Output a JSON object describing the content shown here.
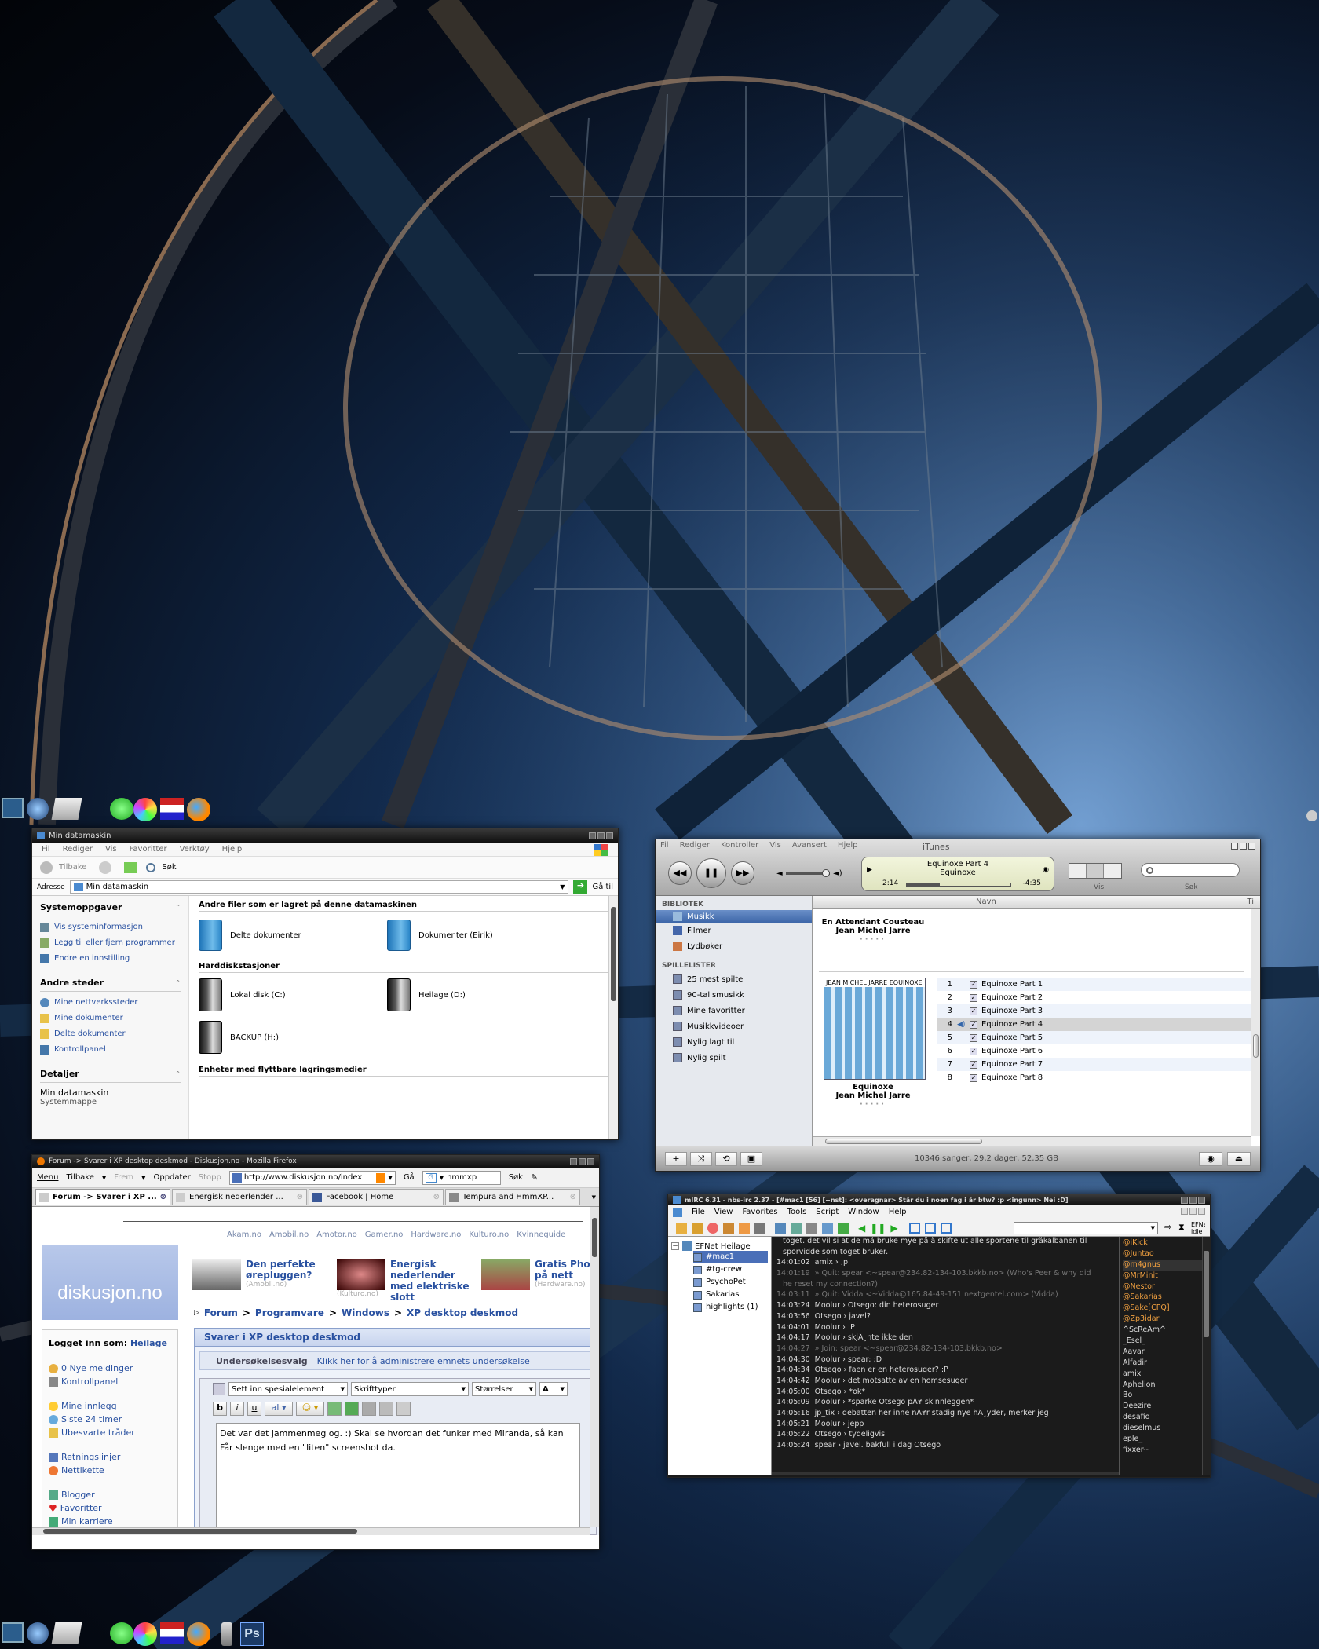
{
  "explorer": {
    "title": "Min datamaskin",
    "menu": [
      "Fil",
      "Rediger",
      "Vis",
      "Favoritter",
      "Verktøy",
      "Hjelp"
    ],
    "toolbar": {
      "back": "Tilbake",
      "search": "Søk"
    },
    "address": {
      "label": "Adresse",
      "value": "Min datamaskin",
      "go": "Gå til"
    },
    "tasks": {
      "title": "Systemoppgaver",
      "items": [
        "Vis systeminformasjon",
        "Legg til eller fjern programmer",
        "Endre en innstilling"
      ]
    },
    "places": {
      "title": "Andre steder",
      "items": [
        "Mine nettverkssteder",
        "Mine dokumenter",
        "Delte dokumenter",
        "Kontrollpanel"
      ]
    },
    "details": {
      "title": "Detaljer",
      "name": "Min datamaskin",
      "desc": "Systemmappe"
    },
    "groups": {
      "files": "Andre filer som er lagret på denne datamaskinen",
      "disks": "Harddiskstasjoner",
      "removable": "Enheter med flyttbare lagringsmedier"
    },
    "items": {
      "shared": "Delte dokumenter",
      "eirik": "Dokumenter (Eirik)",
      "c": "Lokal disk (C:)",
      "d": "Heilage (D:)",
      "h": "BACKUP (H:)"
    }
  },
  "itunes": {
    "title": "iTunes",
    "menu": [
      "Fil",
      "Rediger",
      "Kontroller",
      "Vis",
      "Avansert",
      "Hjelp"
    ],
    "now_playing": {
      "track": "Equinoxe Part 4",
      "album": "Equinoxe",
      "elapsed": "2:14",
      "remaining": "-4:35",
      "progress": 0.32
    },
    "view_label": "Vis",
    "search_label": "Søk",
    "library_header": "BIBLIOTEK",
    "library": [
      "Musikk",
      "Filmer",
      "Lydbøker"
    ],
    "playlists_header": "SPILLELISTER",
    "playlists": [
      "25 mest spilte",
      "90-tallsmusikk",
      "Mine favoritter",
      "Musikkvideoer",
      "Nylig lagt til",
      "Nylig spilt"
    ],
    "columns": {
      "name": "Navn",
      "time": "Ti"
    },
    "album1": {
      "title": "En Attendant Cousteau",
      "artist": "Jean Michel Jarre"
    },
    "album2": {
      "cover": "JEAN MICHEL JARRE  EQUINOXE",
      "title": "Equinoxe",
      "artist": "Jean Michel Jarre"
    },
    "tracks": [
      {
        "n": "1",
        "name": "Equinoxe Part 1"
      },
      {
        "n": "2",
        "name": "Equinoxe Part 2"
      },
      {
        "n": "3",
        "name": "Equinoxe Part 3"
      },
      {
        "n": "4",
        "name": "Equinoxe Part 4"
      },
      {
        "n": "5",
        "name": "Equinoxe Part 5"
      },
      {
        "n": "6",
        "name": "Equinoxe Part 6"
      },
      {
        "n": "7",
        "name": "Equinoxe Part 7"
      },
      {
        "n": "8",
        "name": "Equinoxe Part 8"
      }
    ],
    "status": "10346 sanger, 29,2 dager, 52,35 GB"
  },
  "firefox": {
    "title": "Forum -> Svarer i XP desktop deskmod - Diskusjon.no - Mozilla Firefox",
    "toolbar": {
      "menu": "Menu",
      "back": "Tilbake",
      "forward": "Frem",
      "reload": "Oppdater",
      "stop": "Stopp",
      "url": "http://www.diskusjon.no/index",
      "go": "Gå",
      "search_value": "hmmxp",
      "search_btn": "Søk"
    },
    "tabs": [
      "Forum -> Svarer i XP ...",
      "Energisk nederlender ...",
      "Facebook | Home",
      "Tempura and HmmXP..."
    ],
    "sites": [
      "Akam.no",
      "Amobil.no",
      "Amotor.no",
      "Gamer.no",
      "Hardware.no",
      "Kulturo.no",
      "Kvinneguide"
    ],
    "logo": "diskusjon.no",
    "ads": [
      {
        "title": "Den perfekte ørepluggen?",
        "src": "(Amobil.no)"
      },
      {
        "title": "Energisk nederlender med elektriske slott",
        "src": "(Kulturo.no)"
      },
      {
        "title": "Gratis Phot på nett",
        "src": "(Hardware.no)"
      }
    ],
    "breadcrumb": [
      "Forum",
      "Programvare",
      "Windows",
      "XP desktop deskmod"
    ],
    "logged_label": "Logget inn som:",
    "user": "Heilage",
    "sidebar1": [
      "0 Nye meldinger",
      "Kontrollpanel"
    ],
    "sidebar2": [
      "Mine innlegg",
      "Siste 24 timer",
      "Ubesvarte tråder"
    ],
    "sidebar3": [
      "Retningslinjer",
      "Nettikette"
    ],
    "sidebar4": [
      "Blogger",
      "Favoritter",
      "Min karriere"
    ],
    "reply_title": "Svarer i XP desktop deskmod",
    "poll_label": "Undersøkelsesvalg",
    "poll_link": "Klikk her for å administrere emnets undersøkelse",
    "editor": {
      "special": "Sett inn spesialelement",
      "font": "Skrifttyper",
      "size": "Størrelser",
      "text1": "Det var det jammenmeg og. :) Skal se hvordan det funker med Miranda, så kan",
      "text2": "Får slenge med en \"liten\" screenshot da."
    }
  },
  "mirc": {
    "title": "mIRC 6.31 - nbs-irc 2.37 - [#mac1 [56] [+nst]: <overagnar> Står du i noen fag i år btw? :p <ingunn> Nei :D]",
    "menu": [
      "File",
      "View",
      "Favorites",
      "Tools",
      "Script",
      "Window",
      "Help"
    ],
    "tree": {
      "root": "EFNet Heilage",
      "items": [
        "#mac1",
        "#tg-crew",
        "PsychoPet",
        "Sakarias",
        "highlights (1)"
      ]
    },
    "side_label": "EFNet idle",
    "lines": [
      {
        "t": "",
        "m": "toget. det vil si at de må bruke mye på å skifte ut alle sportene til gråkalbanen til",
        "c": "#ddd"
      },
      {
        "t": "",
        "m": "sporvidde som toget bruker.",
        "c": "#ddd"
      },
      {
        "t": "14:01:02",
        "m": "amix › ;p",
        "c": "#ddd"
      },
      {
        "t": "14:01:19",
        "m": "» Quit: spear <~spear@234.82-134-103.bkkb.no> (Who's Peer & why did",
        "c": "#777"
      },
      {
        "t": "",
        "m": "he reset my connection?)",
        "c": "#777"
      },
      {
        "t": "14:03:11",
        "m": "» Quit: Vidda <~Vidda@165.84-49-151.nextgentel.com> (Vidda)",
        "c": "#777"
      },
      {
        "t": "14:03:24",
        "m": "Moolur › Otsego: din heterosuger",
        "c": "#ddd"
      },
      {
        "t": "14:03:56",
        "m": "Otsego › javel?",
        "c": "#ddd"
      },
      {
        "t": "14:04:01",
        "m": "Moolur › :P",
        "c": "#ddd"
      },
      {
        "t": "14:04:17",
        "m": "Moolur › skjÃ¸nte ikke den",
        "c": "#ddd"
      },
      {
        "t": "14:04:27",
        "m": "» Join: spear <~spear@234.82-134-103.bkkb.no>",
        "c": "#777"
      },
      {
        "t": "14:04:30",
        "m": "Moolur › spear: :D",
        "c": "#ddd"
      },
      {
        "t": "14:04:34",
        "m": "Otsego › faen er en heterosuger? :P",
        "c": "#ddd"
      },
      {
        "t": "14:04:42",
        "m": "Moolur › det motsatte av en homsesuger",
        "c": "#ddd"
      },
      {
        "t": "14:05:00",
        "m": "Otsego › *ok*",
        "c": "#ddd"
      },
      {
        "t": "14:05:09",
        "m": "Moolur › *sparke Otsego pÃ¥ skinnleggen*",
        "c": "#ddd"
      },
      {
        "t": "14:05:16",
        "m": "jp_tix › debatten her inne nÃ¥r stadig nye hÃ¸yder, merker jeg",
        "c": "#ddd"
      },
      {
        "t": "14:05:21",
        "m": "Moolur › jepp",
        "c": "#ddd"
      },
      {
        "t": "14:05:22",
        "m": "Otsego › tydeligvis",
        "c": "#ddd"
      },
      {
        "t": "14:05:24",
        "m": "spear › javel. bakfull i dag Otsego",
        "c": "#ddd"
      }
    ],
    "nicks": [
      {
        "n": "@iKick",
        "c": "#f0a040"
      },
      {
        "n": "@Juntao",
        "c": "#f0a040"
      },
      {
        "n": "@m4gnus",
        "c": "#f0a040"
      },
      {
        "n": "@MrMinit",
        "c": "#f0a040"
      },
      {
        "n": "@Nestor",
        "c": "#f0a040"
      },
      {
        "n": "@Sakarias",
        "c": "#f0a040"
      },
      {
        "n": "@Sake[CPQ]",
        "c": "#f0a040"
      },
      {
        "n": "@Zp3idar",
        "c": "#f0a040"
      },
      {
        "n": "^ScReAm^",
        "c": "#ddd"
      },
      {
        "n": "_Esel_",
        "c": "#ddd"
      },
      {
        "n": "Aavar",
        "c": "#ddd"
      },
      {
        "n": "Alfadir",
        "c": "#ddd"
      },
      {
        "n": "amix",
        "c": "#ddd"
      },
      {
        "n": "Aphelion",
        "c": "#ddd"
      },
      {
        "n": "Bo",
        "c": "#ddd"
      },
      {
        "n": "Deezire",
        "c": "#ddd"
      },
      {
        "n": "desafio",
        "c": "#ddd"
      },
      {
        "n": "dieselmus",
        "c": "#ddd"
      },
      {
        "n": "eple_",
        "c": "#ddd"
      },
      {
        "n": "fixxer--",
        "c": "#ddd"
      }
    ]
  },
  "dock": {
    "photoshop": "Ps"
  }
}
